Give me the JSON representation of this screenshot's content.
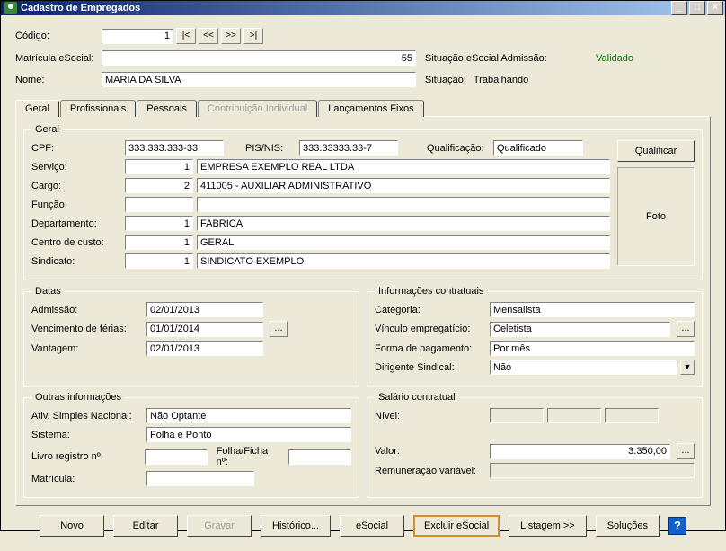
{
  "window": {
    "title": "Cadastro de Empregados"
  },
  "header": {
    "codigo_label": "Código:",
    "codigo_value": "1",
    "nav_first": "|<",
    "nav_prev": "<<",
    "nav_next": ">>",
    "nav_last": ">|",
    "matricula_label": "Matrícula eSocial:",
    "matricula_value": "55",
    "situacao_esocial_label": "Situação eSocial Admissão:",
    "situacao_esocial_value": "Validado",
    "nome_label": "Nome:",
    "nome_value": "MARIA DA SILVA",
    "situacao_label": "Situação:",
    "situacao_value": "Trabalhando"
  },
  "tabs": {
    "geral": "Geral",
    "profissionais": "Profissionais",
    "pessoais": "Pessoais",
    "contrib": "Contribuição Individual",
    "lanc": "Lançamentos Fixos"
  },
  "geral": {
    "box_title": "Geral",
    "cpf_label": "CPF:",
    "cpf_value": "333.333.333-33",
    "pisnis_label": "PIS/NIS:",
    "pisnis_value": "333.33333.33-7",
    "qualif_label": "Qualificação:",
    "qualif_value": "Qualificado",
    "qualificar_btn": "Qualificar",
    "servico_label": "Serviço:",
    "servico_code": "1",
    "servico_value": "EMPRESA EXEMPLO REAL LTDA",
    "cargo_label": "Cargo:",
    "cargo_code": "2",
    "cargo_value": "411005 - AUXILIAR ADMINISTRATIVO",
    "funcao_label": "Função:",
    "funcao_code": "",
    "funcao_value": "",
    "depto_label": "Departamento:",
    "depto_code": "1",
    "depto_value": "FABRICA",
    "cc_label": "Centro de custo:",
    "cc_code": "1",
    "cc_value": "GERAL",
    "sind_label": "Sindicato:",
    "sind_code": "1",
    "sind_value": "SINDICATO EXEMPLO",
    "foto_label": "Foto"
  },
  "datas": {
    "box_title": "Datas",
    "admissao_label": "Admissão:",
    "admissao_value": "02/01/2013",
    "venc_label": "Vencimento de férias:",
    "venc_value": "01/01/2014",
    "vant_label": "Vantagem:",
    "vant_value": "02/01/2013"
  },
  "info": {
    "box_title": "Informações contratuais",
    "categoria_label": "Categoria:",
    "categoria_value": "Mensalista",
    "vinculo_label": "Vínculo empregatício:",
    "vinculo_value": "Celetista",
    "forma_label": "Forma de pagamento:",
    "forma_value": "Por mês",
    "dirigente_label": "Dirigente Sindical:",
    "dirigente_value": "Não"
  },
  "outras": {
    "box_title": "Outras informações",
    "simples_label": "Ativ. Simples Nacional:",
    "simples_value": "Não Optante",
    "sistema_label": "Sistema:",
    "sistema_value": "Folha e Ponto",
    "livro_label": "Livro registro nº:",
    "livro_value": "",
    "folha_label": "Folha/Ficha nº:",
    "folha_value": "",
    "matricula_label": "Matrícula:",
    "matricula_value": ""
  },
  "salario": {
    "box_title": "Salário contratual",
    "nivel_label": "Nível:",
    "valor_label": "Valor:",
    "valor_value": "3.350,00",
    "remun_label": "Remuneração variável:"
  },
  "footer": {
    "novo": "Novo",
    "editar": "Editar",
    "gravar": "Gravar",
    "historico": "Histórico...",
    "esocial": "eSocial",
    "excluir": "Excluir eSocial",
    "listagem": "Listagem >>",
    "solucoes": "Soluções",
    "help": "?"
  }
}
